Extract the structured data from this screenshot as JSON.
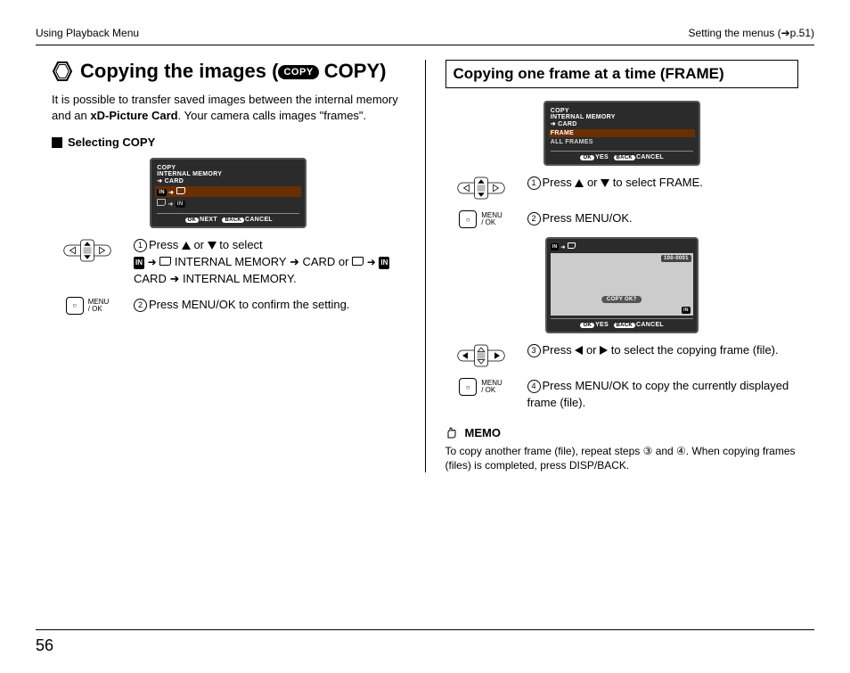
{
  "header": {
    "left": "Using Playback Menu",
    "right": "Setting the menus (➔p.51)"
  },
  "left": {
    "title_pre": "Copying the images (",
    "title_badge": "COPY",
    "title_post": " COPY)",
    "intro_a": "It is possible to transfer saved images between the internal memory and an ",
    "intro_bold": "xD-Picture Card",
    "intro_b": ". Your camera calls images \"frames\".",
    "subhead": "Selecting COPY",
    "lcd": {
      "l1": "COPY",
      "l2": "INTERNAL MEMORY",
      "l3": "➜ CARD",
      "bar_ok": "OK",
      "bar_next": "NEXT",
      "bar_back": "BACK",
      "bar_cancel": "CANCEL"
    },
    "step1_a": "Press ",
    "step1_b": " or ",
    "step1_c": " to select",
    "step1_line2_a": " INTERNAL MEMORY ➜ CARD or ",
    "step1_line2_b": " CARD ➜ INTERNAL MEMORY.",
    "menuok_lbl1": "MENU",
    "menuok_lbl2": "/ OK",
    "step2": "Press MENU/OK to confirm the setting."
  },
  "right": {
    "title": "Copying one frame at a time (FRAME)",
    "lcd1": {
      "l1": "COPY",
      "l2": "INTERNAL MEMORY",
      "l3": "➜ CARD",
      "opt1": "FRAME",
      "opt2": "ALL FRAMES",
      "bar_ok": "OK",
      "bar_yes": "YES",
      "bar_back": "BACK",
      "bar_cancel": "CANCEL"
    },
    "step1_a": "Press ",
    "step1_b": " or ",
    "step1_c": " to select FRAME.",
    "step2": "Press MENU/OK.",
    "lcd2": {
      "fileno": "100-0001",
      "q": "COPY OK?",
      "bar_ok": "OK",
      "bar_yes": "YES",
      "bar_back": "BACK",
      "bar_cancel": "CANCEL"
    },
    "step3_a": "Press ",
    "step3_b": " or ",
    "step3_c": " to select the copying frame (file).",
    "step4": "Press MENU/OK to copy the currently displayed frame (file).",
    "memo_label": "MEMO",
    "memo_text": "To copy another frame (file), repeat steps ③ and ④. When copying frames (files) is completed, press DISP/BACK."
  },
  "pagenum": "56"
}
